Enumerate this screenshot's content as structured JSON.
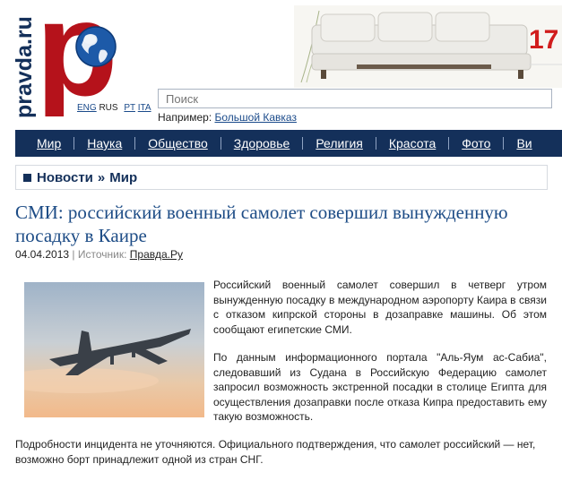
{
  "logo": {
    "site_name": "pravda.ru",
    "letter": "p",
    "languages": [
      "ENG",
      "RUS",
      "PT",
      "ITA"
    ]
  },
  "banner": {
    "number_text": "17"
  },
  "search": {
    "placeholder": "Поиск",
    "example_prefix": "Например: ",
    "example_link": "Большой Кавказ"
  },
  "nav": {
    "items": [
      "Мир",
      "Наука",
      "Общество",
      "Здоровье",
      "Религия",
      "Красота",
      "Фото",
      "Ви"
    ]
  },
  "breadcrumb": {
    "section": "Новости",
    "separator": "»",
    "subsection": "Мир"
  },
  "article": {
    "headline": "СМИ: российский военный самолет совершил вынужденную посадку в Каире",
    "date": "04.04.2013",
    "meta_sep": "|",
    "source_label": "Источник:",
    "source": "Правда.Ру",
    "paragraph_1": "Российский военный самолет совершил в четверг утром вынужденную посадку в международном аэропорту Каира в связи с отказом кипрской стороны в дозаправке машины. Об этом сообщают египетские СМИ.",
    "paragraph_2": "По данным информационного портала \"Аль-Яум ас-Сабиа\", следовавший из Судана в Российскую Федерацию самолет запросил возможность экстренной посадки в столице Египта для осуществления дозаправки после отказа Кипра предоставить ему такую возможность.",
    "paragraph_3": "Подробности инцидента не уточняются. Официального подтверждения, что самолет российский — нет, возможно борт принадлежит одной из стран СНГ."
  },
  "colors": {
    "nav_bg": "#14305a",
    "brand_red": "#b5121b",
    "headline_blue": "#1d4c86"
  }
}
